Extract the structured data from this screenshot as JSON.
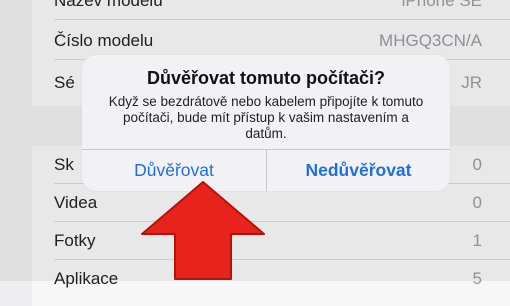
{
  "settings": {
    "rows_top": [
      {
        "label": "Název modelu",
        "value": "iPhone SE"
      },
      {
        "label": "Číslo modelu",
        "value": "MHGQ3CN/A"
      },
      {
        "label": "Sé",
        "value": "JR"
      }
    ],
    "rows_bottom": [
      {
        "label": "Sk",
        "value": "0"
      },
      {
        "label": "Videa",
        "value": "0"
      },
      {
        "label": "Fotky",
        "value": "1"
      },
      {
        "label": "Aplikace",
        "value": "5"
      }
    ]
  },
  "alert": {
    "title": "Důvěřovat tomuto počítači?",
    "message": "Když se bezdrátově nebo kabelem připojíte k tomuto počítači, bude mít přístup k vašim nastavením a datům.",
    "buttons": {
      "trust": "Důvěřovat",
      "dont_trust": "Nedůvěřovat"
    }
  },
  "colors": {
    "button_blue": "#1f6fe0",
    "arrow_red": "#e8231b"
  },
  "annotation": {
    "icon": "red-up-arrow"
  }
}
